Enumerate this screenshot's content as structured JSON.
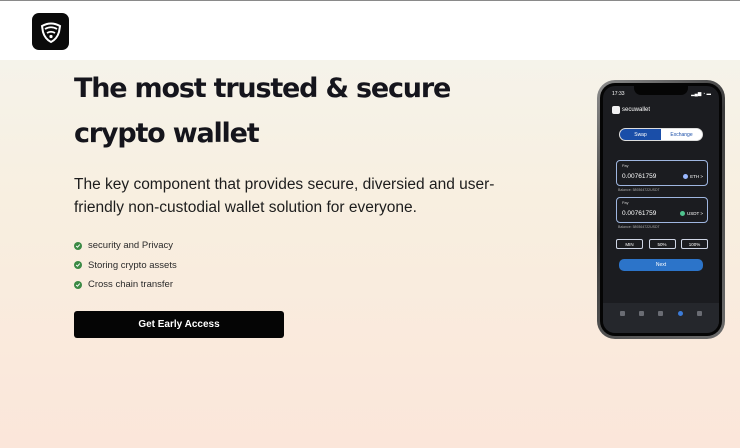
{
  "hero": {
    "headline_line1": "The most trusted & secure",
    "headline_line2": "crypto wallet",
    "subtext": "The key component that provides secure, diversied and user-friendly non-custodial wallet solution for everyone.",
    "features": [
      "security and Privacy",
      "Storing crypto assets",
      "Cross chain transfer"
    ],
    "cta_label": "Get Early Access"
  },
  "phone": {
    "time": "17:33",
    "status_icons": "▂▄▆ ◔ ▬",
    "app_name": "secuwallet",
    "tabs": [
      "Swap",
      "Exchange"
    ],
    "pay_field": {
      "label": "Pay",
      "amount": "0.00761759",
      "token": "ETH >",
      "balance": "Balance: 589364722USDT"
    },
    "receive_field": {
      "label": "Pay",
      "amount": "0.00761759",
      "token": "USDT >",
      "balance": "Balance: 589364722USDT"
    },
    "percent_buttons": [
      "MIN",
      "50%",
      "100%"
    ],
    "next_label": "Next",
    "tabbar_icons": [
      "wallet-tab-icon",
      "chart-tab-icon",
      "grid-tab-icon",
      "swap-tab-icon",
      "lock-tab-icon"
    ]
  },
  "colors": {
    "check": "#3c8a45",
    "cta_bg": "#050505",
    "accent_blue": "#2c74c9"
  }
}
